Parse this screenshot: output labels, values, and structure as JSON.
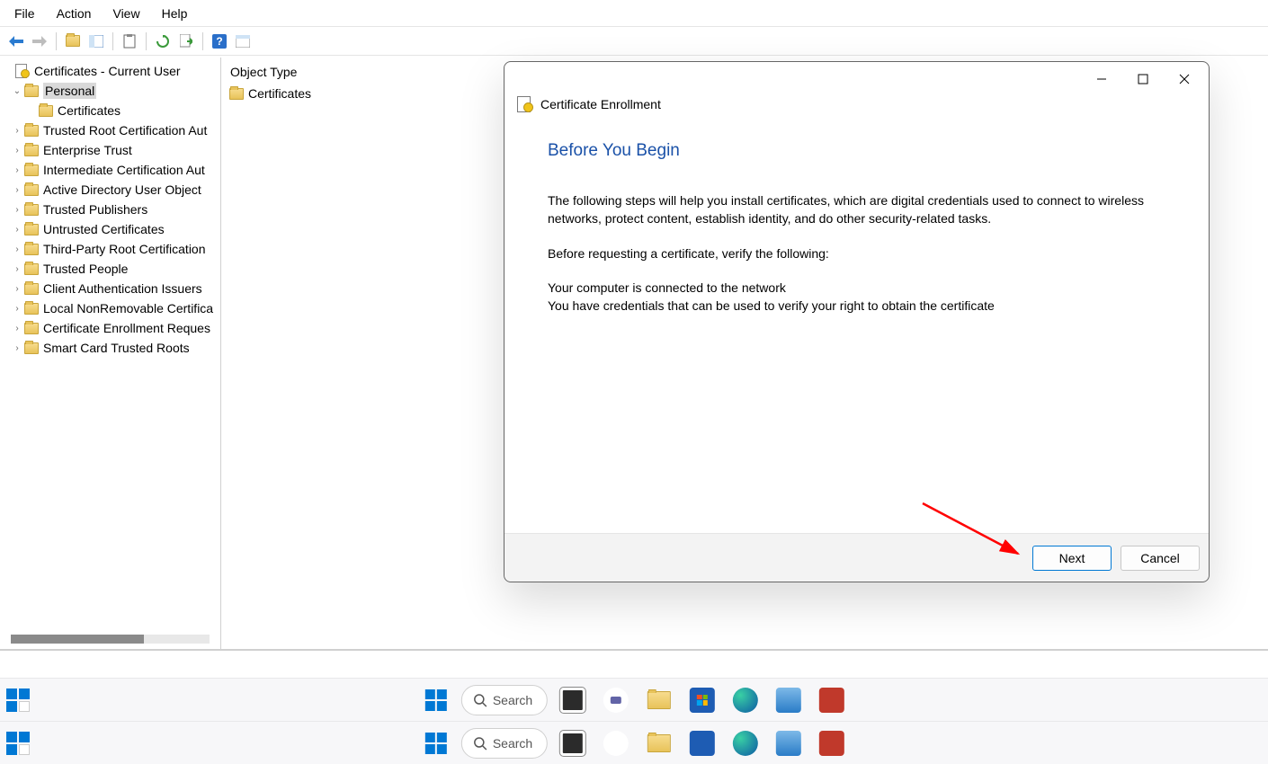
{
  "menubar": [
    "File",
    "Action",
    "View",
    "Help"
  ],
  "tree": {
    "root": "Certificates - Current User",
    "selected": "Personal",
    "child_of_selected": "Certificates",
    "items": [
      "Trusted Root Certification Aut",
      "Enterprise Trust",
      "Intermediate Certification Aut",
      "Active Directory User Object",
      "Trusted Publishers",
      "Untrusted Certificates",
      "Third-Party Root Certification",
      "Trusted People",
      "Client Authentication Issuers",
      "Local NonRemovable Certifica",
      "Certificate Enrollment Reques",
      "Smart Card Trusted Roots"
    ]
  },
  "list": {
    "header": "Object Type",
    "row": "Certificates"
  },
  "dialog": {
    "title": "Certificate Enrollment",
    "heading": "Before You Begin",
    "p1": "The following steps will help you install certificates, which are digital credentials used to connect to wireless networks, protect content, establish identity, and do other security-related tasks.",
    "p2": "Before requesting a certificate, verify the following:",
    "p3": "Your computer is connected to the network",
    "p4": "You have credentials that can be used to verify your right to obtain the certificate",
    "next": "Next",
    "cancel": "Cancel"
  },
  "taskbar": {
    "search": "Search"
  }
}
